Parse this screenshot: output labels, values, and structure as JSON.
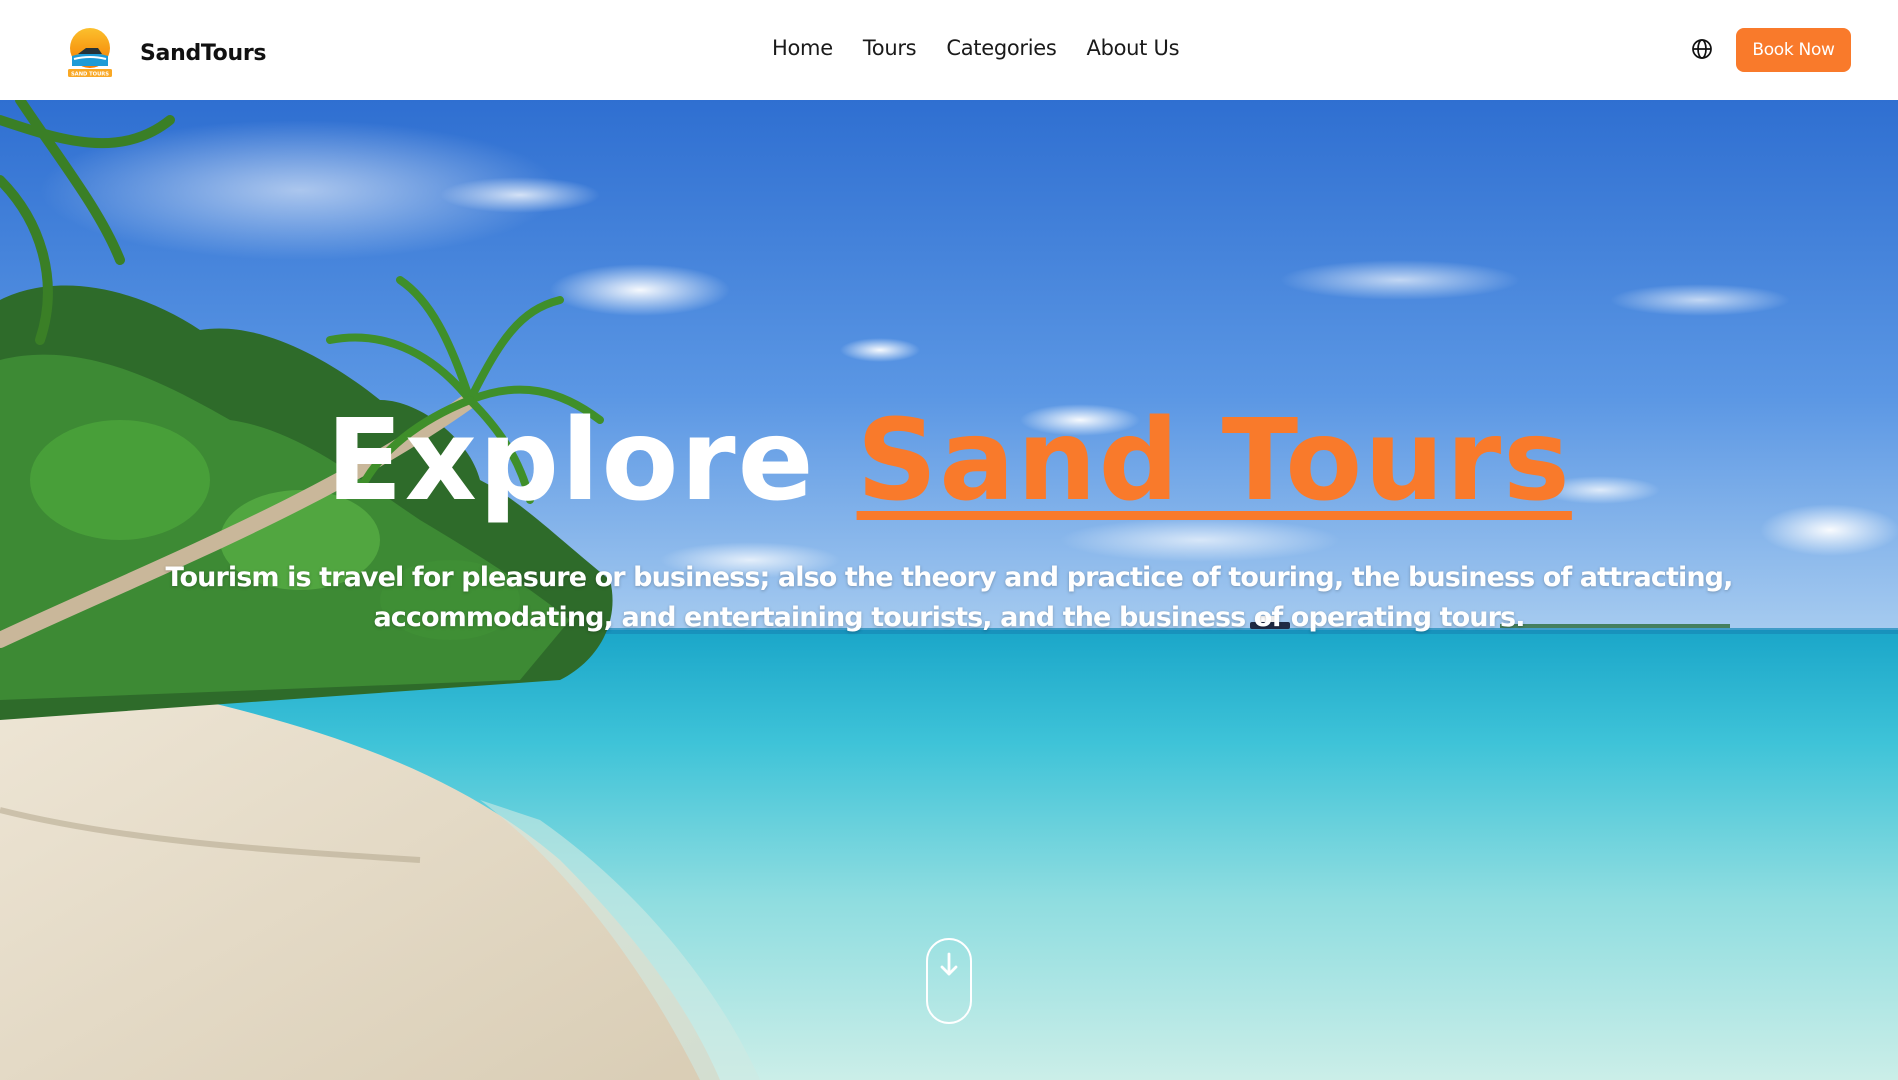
{
  "header": {
    "brand_name": "SandTours",
    "logo_text": "SAND TOURS",
    "nav": [
      {
        "label": "Home"
      },
      {
        "label": "Tours"
      },
      {
        "label": "Categories"
      },
      {
        "label": "About Us"
      }
    ],
    "language_icon": "globe-icon",
    "book_button_label": "Book Now"
  },
  "hero": {
    "title_prefix": "Explore",
    "title_accent": "Sand Tours",
    "subtitle": "Tourism is travel for pleasure or business; also the theory and practice of touring, the business of attracting, accommodating, and entertaining tourists, and the business of operating tours.",
    "scroll_icon": "arrow-down-icon",
    "background": "tropical beach with palm trees, white sand and turquoise sea"
  },
  "colors": {
    "accent": "#f97a2b",
    "header_bg": "#ffffff",
    "hero_text": "#ffffff"
  }
}
